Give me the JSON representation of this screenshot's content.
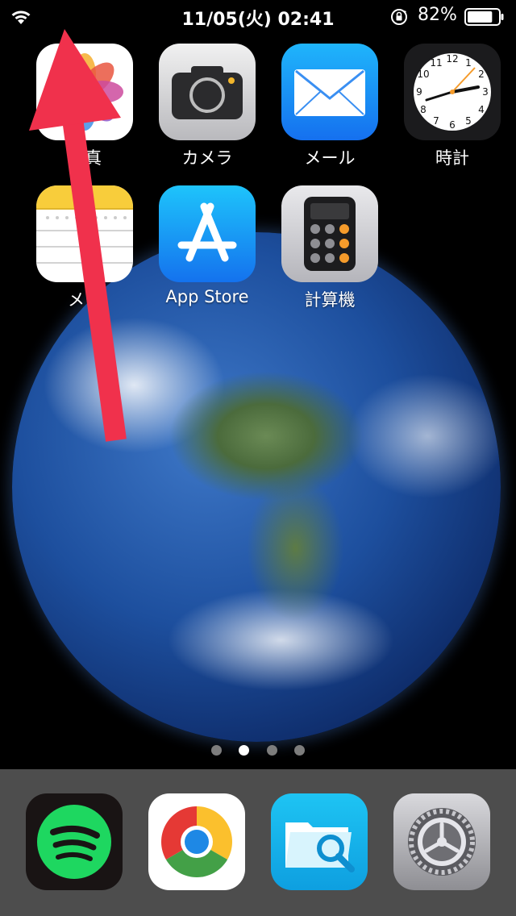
{
  "status_bar": {
    "datetime": "11/05(火) 02:41",
    "battery_percent": "82%",
    "battery_level": 0.82,
    "wifi_icon": "wifi-icon",
    "orientation_lock_icon": "rotation-lock-icon"
  },
  "home_apps": [
    {
      "label": "写真",
      "icon": "photos-icon"
    },
    {
      "label": "カメラ",
      "icon": "camera-icon"
    },
    {
      "label": "メール",
      "icon": "mail-icon"
    },
    {
      "label": "時計",
      "icon": "clock-icon"
    },
    {
      "label": "メモ",
      "icon": "notes-icon"
    },
    {
      "label": "App Store",
      "icon": "app-store-icon"
    },
    {
      "label": "計算機",
      "icon": "calculator-icon"
    }
  ],
  "page_dots": {
    "count": 4,
    "active_index": 1
  },
  "dock_apps": [
    {
      "icon": "spotify-icon"
    },
    {
      "icon": "chrome-icon"
    },
    {
      "icon": "file-search-icon"
    },
    {
      "icon": "settings-icon"
    }
  ],
  "colors": {
    "annotation_arrow": "#f0314c",
    "spotify_green": "#1ed760",
    "mail_blue": "#1a9bf7",
    "app_store_blue": "#1d8ef5",
    "calculator_orange": "#f59b2b"
  }
}
